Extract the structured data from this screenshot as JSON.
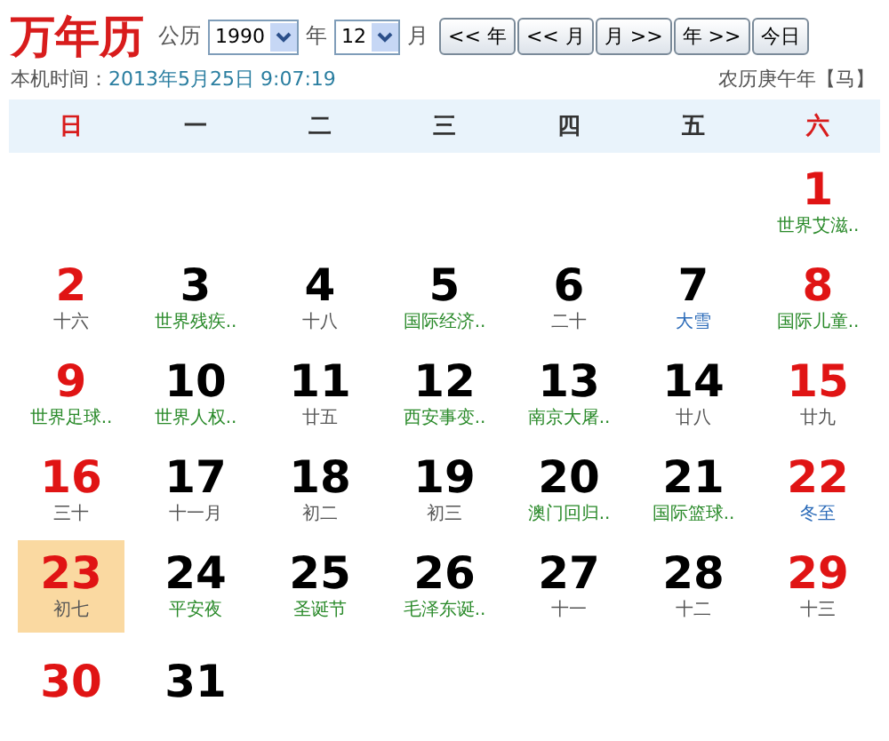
{
  "title": "万年历",
  "calendar_label": "公历",
  "year": {
    "value": "1990",
    "unit": "年"
  },
  "month": {
    "value": "12",
    "unit": "月"
  },
  "nav_buttons": [
    "<< 年",
    "<< 月",
    "月 >>",
    "年 >>",
    "今日"
  ],
  "clock": {
    "label": "本机时间：",
    "value": "2013年5月25日 9:07:19"
  },
  "lunar_year": "农历庚午年【马】",
  "weekdays": [
    "日",
    "一",
    "二",
    "三",
    "四",
    "五",
    "六"
  ],
  "weeks": [
    [
      {
        "day": "1",
        "note": "世界艾滋..",
        "kind": "festival",
        "selected": false
      }
    ],
    [
      {
        "day": "2",
        "note": "十六",
        "kind": "lunar",
        "selected": false
      },
      {
        "day": "3",
        "note": "世界残疾..",
        "kind": "festival",
        "selected": false
      },
      {
        "day": "4",
        "note": "十八",
        "kind": "lunar",
        "selected": false
      },
      {
        "day": "5",
        "note": "国际经济..",
        "kind": "festival",
        "selected": false
      },
      {
        "day": "6",
        "note": "二十",
        "kind": "lunar",
        "selected": false
      },
      {
        "day": "7",
        "note": "大雪",
        "kind": "term",
        "selected": false
      },
      {
        "day": "8",
        "note": "国际儿童..",
        "kind": "festival",
        "selected": false
      }
    ],
    [
      {
        "day": "9",
        "note": "世界足球..",
        "kind": "festival",
        "selected": false
      },
      {
        "day": "10",
        "note": "世界人权..",
        "kind": "festival",
        "selected": false
      },
      {
        "day": "11",
        "note": "廿五",
        "kind": "lunar",
        "selected": false
      },
      {
        "day": "12",
        "note": "西安事变..",
        "kind": "festival",
        "selected": false
      },
      {
        "day": "13",
        "note": "南京大屠..",
        "kind": "festival",
        "selected": false
      },
      {
        "day": "14",
        "note": "廿八",
        "kind": "lunar",
        "selected": false
      },
      {
        "day": "15",
        "note": "廿九",
        "kind": "lunar",
        "selected": false
      }
    ],
    [
      {
        "day": "16",
        "note": "三十",
        "kind": "lunar",
        "selected": false
      },
      {
        "day": "17",
        "note": "十一月",
        "kind": "lunar",
        "selected": false
      },
      {
        "day": "18",
        "note": "初二",
        "kind": "lunar",
        "selected": false
      },
      {
        "day": "19",
        "note": "初三",
        "kind": "lunar",
        "selected": false
      },
      {
        "day": "20",
        "note": "澳门回归..",
        "kind": "festival",
        "selected": false
      },
      {
        "day": "21",
        "note": "国际篮球..",
        "kind": "festival",
        "selected": false
      },
      {
        "day": "22",
        "note": "冬至",
        "kind": "term",
        "selected": false
      }
    ],
    [
      {
        "day": "23",
        "note": "初七",
        "kind": "lunar",
        "selected": true
      },
      {
        "day": "24",
        "note": "平安夜",
        "kind": "festival",
        "selected": false
      },
      {
        "day": "25",
        "note": "圣诞节",
        "kind": "festival",
        "selected": false
      },
      {
        "day": "26",
        "note": "毛泽东诞..",
        "kind": "festival",
        "selected": false
      },
      {
        "day": "27",
        "note": "十一",
        "kind": "lunar",
        "selected": false
      },
      {
        "day": "28",
        "note": "十二",
        "kind": "lunar",
        "selected": false
      },
      {
        "day": "29",
        "note": "十三",
        "kind": "lunar",
        "selected": false
      }
    ],
    [
      {
        "day": "30",
        "selected": false
      },
      {
        "day": "31",
        "selected": false
      }
    ]
  ]
}
